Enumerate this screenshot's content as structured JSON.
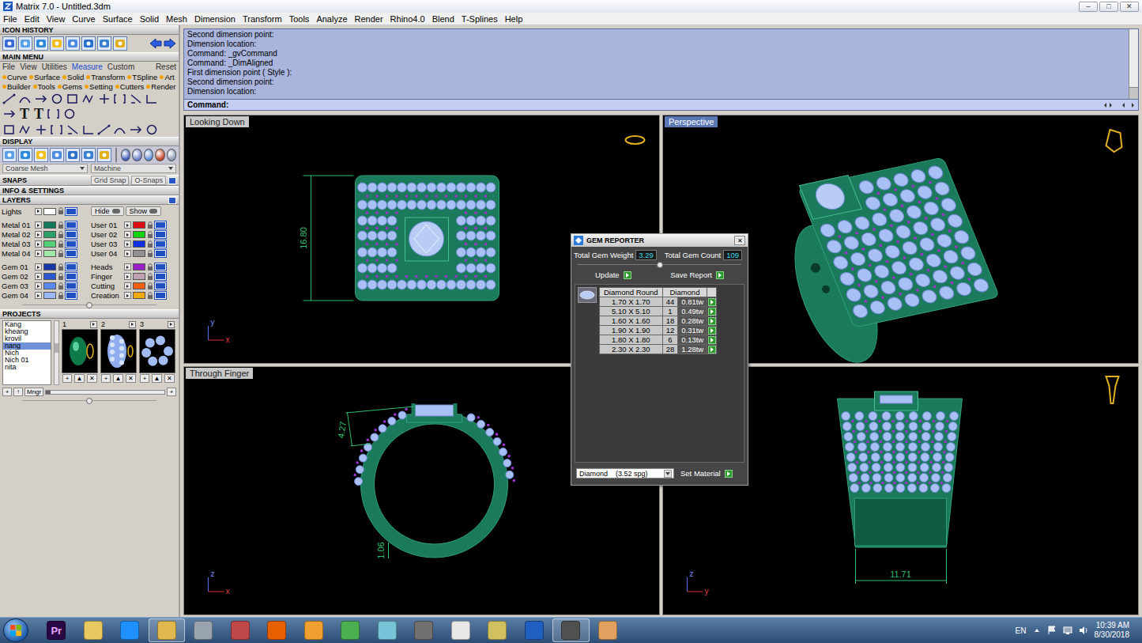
{
  "window": {
    "title": "Matrix 7.0 - Untitled.3dm",
    "controls": [
      "–",
      "□",
      "✕"
    ]
  },
  "menu_bar": [
    "File",
    "Edit",
    "View",
    "Curve",
    "Surface",
    "Solid",
    "Mesh",
    "Dimension",
    "Transform",
    "Tools",
    "Analyze",
    "Render",
    "Rhino4.0",
    "Blend",
    "T-Splines",
    "Help"
  ],
  "left_panel": {
    "icon_history": {
      "title": "ICON HISTORY"
    },
    "main_menu": {
      "title": "MAIN MENU",
      "tabs": [
        {
          "label": "File",
          "selected": false
        },
        {
          "label": "View",
          "selected": false
        },
        {
          "label": "Utilities",
          "selected": false
        },
        {
          "label": "Measure",
          "selected": true
        },
        {
          "label": "Custom",
          "selected": false
        }
      ],
      "reset": "Reset",
      "categories": [
        [
          "Curve",
          "Surface",
          "Solid",
          "Transform",
          "TSpline",
          "Art"
        ],
        [
          "Builder",
          "Tools",
          "Gems",
          "Setting",
          "Cutters",
          "Render"
        ]
      ],
      "tool_glyphs": [
        "T",
        "T"
      ]
    },
    "display": {
      "title": "DISPLAY",
      "mesh": "Coarse Mesh",
      "material": "Machine"
    },
    "snaps": {
      "title": "SNAPS",
      "grid": "Grid Snap",
      "osnaps": "O-Snaps"
    },
    "info": {
      "title": "INFO & SETTINGS"
    },
    "layers": {
      "title": "LAYERS",
      "lights": {
        "name": "Lights",
        "color": "#ffffff",
        "hide": "Hide",
        "show": "Show"
      },
      "groups": [
        {
          "left": [
            {
              "name": "Metal 01",
              "color": "#127a5a"
            },
            {
              "name": "Metal 02",
              "color": "#2aa068"
            },
            {
              "name": "Metal 03",
              "color": "#56d078"
            },
            {
              "name": "Metal 04",
              "color": "#a0e8a8"
            }
          ],
          "right": [
            {
              "name": "User 01",
              "color": "#e01010"
            },
            {
              "name": "User 02",
              "color": "#10d010"
            },
            {
              "name": "User 03",
              "color": "#1030e0"
            },
            {
              "name": "User 04",
              "color": "#909090"
            }
          ]
        },
        {
          "left": [
            {
              "name": "Gem 01",
              "color": "#1838a8"
            },
            {
              "name": "Gem 02",
              "color": "#2a58d0"
            },
            {
              "name": "Gem 03",
              "color": "#5a88ec"
            },
            {
              "name": "Gem 04",
              "color": "#9ab8f4"
            }
          ],
          "right": [
            {
              "name": "Heads",
              "color": "#9a20c8"
            },
            {
              "name": "Finger",
              "color": "#c0a0b0"
            },
            {
              "name": "Cutting",
              "color": "#f06010"
            },
            {
              "name": "Creation",
              "color": "#f0a810"
            }
          ]
        }
      ]
    },
    "projects": {
      "title": "PROJECTS",
      "items": [
        {
          "name": "Kang",
          "selected": false
        },
        {
          "name": "kheang",
          "selected": false
        },
        {
          "name": "krovil",
          "selected": false
        },
        {
          "name": "nang",
          "selected": true
        },
        {
          "name": "Nich",
          "selected": false
        },
        {
          "name": "Nich 01",
          "selected": false
        },
        {
          "name": "nita",
          "selected": false
        }
      ],
      "thumbnails": [
        {
          "number": "1",
          "kind": "emerald"
        },
        {
          "number": "2",
          "kind": "cluster"
        },
        {
          "number": "3",
          "kind": "ring"
        }
      ],
      "thumb_buttons": [
        "+",
        "▲",
        "✕"
      ],
      "footer_buttons": [
        "+",
        "↑"
      ],
      "manager": "Mngr",
      "add": "+"
    }
  },
  "command": {
    "history": [
      "Second dimension point:",
      "Dimension location:",
      "Command: _gvCommand",
      "Command: _DimAligned",
      "First dimension point ( Style ):",
      "Second dimension point:",
      "Dimension location:"
    ],
    "prompt": "Command:"
  },
  "viewports": [
    {
      "label": "Looking Down",
      "selected": false,
      "kind": "top",
      "dimensions": [
        "16.80"
      ],
      "axes": [
        "y",
        "x"
      ]
    },
    {
      "label": "Perspective",
      "selected": true,
      "kind": "perspective",
      "dimensions": [],
      "axes": []
    },
    {
      "label": "Through Finger",
      "selected": false,
      "kind": "front",
      "dimensions": [
        "4.27",
        "1.06"
      ],
      "axes": [
        "z",
        "x"
      ]
    },
    {
      "label": "",
      "selected": false,
      "kind": "side",
      "dimensions": [
        "11.71"
      ],
      "axes": [
        "z",
        "y"
      ]
    }
  ],
  "gem_reporter": {
    "title": "GEM REPORTER",
    "close": "✕",
    "weight_label": "Total Gem Weight",
    "weight": "3.29",
    "count_label": "Total Gem Count",
    "count": "109",
    "update": "Update",
    "save": "Save Report",
    "columns": [
      "Diamond Round",
      "Diamond"
    ],
    "rows": [
      {
        "size": "1.70 X 1.70",
        "count": "44",
        "weight": "0.81tw"
      },
      {
        "size": "5.10 X 5.10",
        "count": "1",
        "weight": "0.49tw"
      },
      {
        "size": "1.60 X 1.60",
        "count": "18",
        "weight": "0.28tw"
      },
      {
        "size": "1.90 X 1.90",
        "count": "12",
        "weight": "0.31tw"
      },
      {
        "size": "1.80 X 1.80",
        "count": "6",
        "weight": "0.13tw"
      },
      {
        "size": "2.30 X 2.30",
        "count": "28",
        "weight": "1.28tw"
      }
    ],
    "material": "Diamond    (3.52 spg)",
    "set_material": "Set Material"
  },
  "taskbar": {
    "apps": [
      {
        "label": "Pr",
        "color": "#2a0845",
        "active": false
      },
      {
        "label": "",
        "color": "#e8c860",
        "active": false
      },
      {
        "label": "",
        "color": "#1e90ff",
        "active": false
      },
      {
        "label": "",
        "color": "#e0b850",
        "active": true
      },
      {
        "label": "",
        "color": "#9aa4b0",
        "active": false
      },
      {
        "label": "",
        "color": "#c04848",
        "active": false
      },
      {
        "label": "",
        "color": "#e66000",
        "active": false
      },
      {
        "label": "",
        "color": "#f0a030",
        "active": false
      },
      {
        "label": "",
        "color": "#4caf50",
        "active": false
      },
      {
        "label": "",
        "color": "#78c4d8",
        "active": false
      },
      {
        "label": "",
        "color": "#707070",
        "active": false
      },
      {
        "label": "",
        "color": "#e8e8e8",
        "active": false
      },
      {
        "label": "",
        "color": "#d0c060",
        "active": false
      },
      {
        "label": "",
        "color": "#2060c0",
        "active": false
      },
      {
        "label": "",
        "color": "#505050",
        "active": true
      },
      {
        "label": "",
        "color": "#e0a060",
        "active": false
      }
    ],
    "language": "EN",
    "time": "10:39 AM",
    "date": "8/30/2018"
  }
}
